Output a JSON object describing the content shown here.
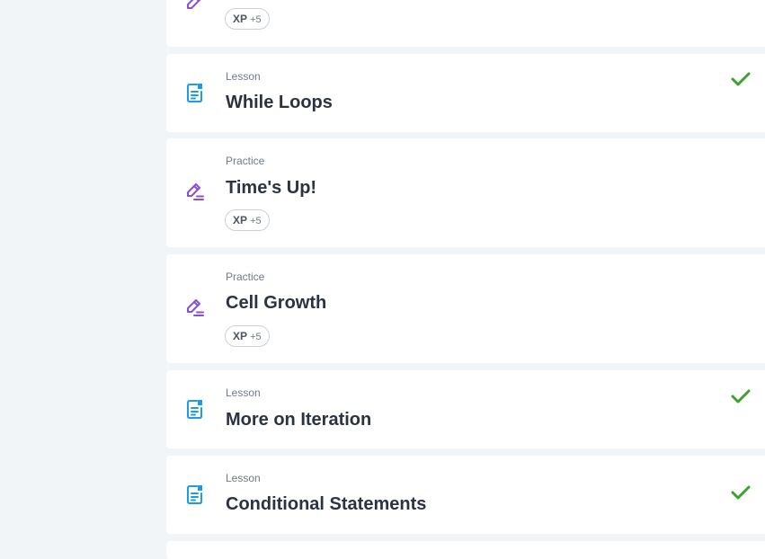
{
  "items": [
    {
      "kind": "",
      "title": "",
      "xp_label": "XP",
      "xp_value": "+5",
      "completed": false,
      "icon": "practice-pencil-icon"
    },
    {
      "kind": "Lesson",
      "title": "While Loops",
      "completed": true,
      "icon": "lesson-document-icon"
    },
    {
      "kind": "Practice",
      "title": "Time's Up!",
      "xp_label": "XP",
      "xp_value": "+5",
      "completed": false,
      "icon": "practice-pencil-icon"
    },
    {
      "kind": "Practice",
      "title": "Cell Growth",
      "xp_label": "XP",
      "xp_value": "+5",
      "completed": false,
      "icon": "practice-pencil-icon"
    },
    {
      "kind": "Lesson",
      "title": "More on Iteration",
      "completed": true,
      "icon": "lesson-document-icon"
    },
    {
      "kind": "Lesson",
      "title": "Conditional Statements",
      "completed": true,
      "icon": "lesson-document-icon"
    }
  ],
  "colors": {
    "background": "#f2f5f7",
    "card": "#ffffff",
    "lesson_icon": "#1e9be8",
    "practice_icon": "#8a4fd8",
    "check": "#3ba22a",
    "title": "#2b3340",
    "kind": "#6d7b8a"
  }
}
